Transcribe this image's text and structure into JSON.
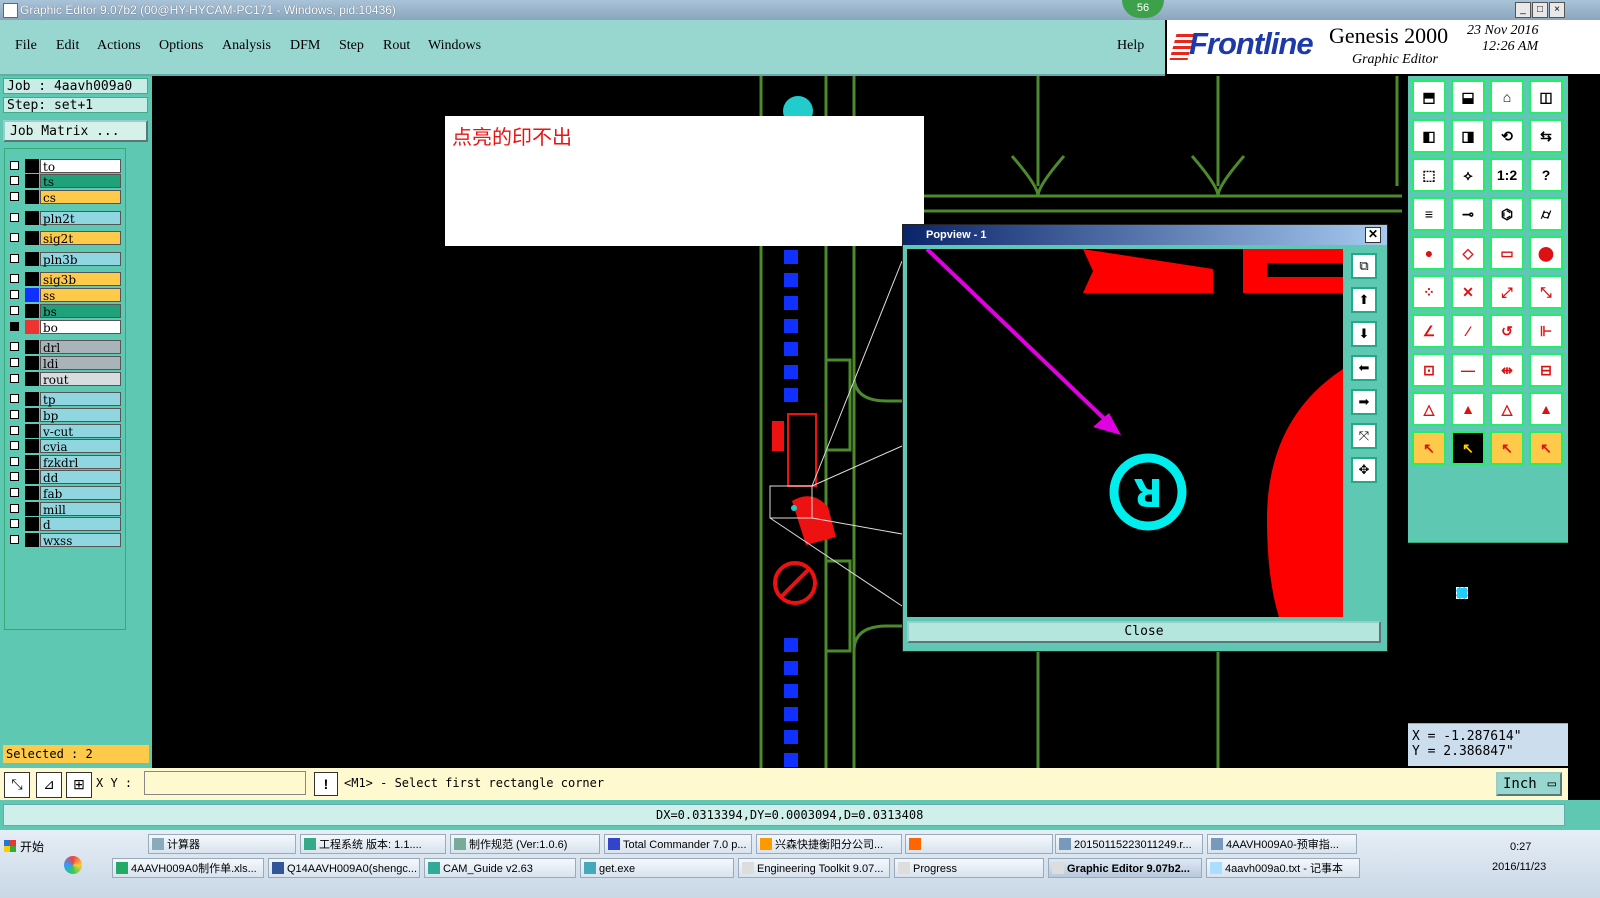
{
  "window": {
    "title": "Graphic Editor 9.07b2 (00@HY-HYCAM-PC171 - Windows, pid:10436)",
    "badge": "56",
    "buttons": [
      "_",
      "□",
      "×"
    ]
  },
  "menu": {
    "items": [
      "File",
      "Edit",
      "Actions",
      "Options",
      "Analysis",
      "DFM",
      "Step",
      "Rout",
      "Windows"
    ],
    "help": "Help"
  },
  "brand": {
    "logo": "Frontline",
    "product": "Genesis 2000",
    "subtitle": "Graphic Editor",
    "date": "23 Nov 2016",
    "time": "12:26 AM"
  },
  "job": {
    "job_line": "Job : 4aavh009a0",
    "step_line": "Step: set+1",
    "matrix_button": "Job Matrix ...",
    "selected": "Selected : 2"
  },
  "layers": [
    {
      "name": "to",
      "color": "#ffffff"
    },
    {
      "name": "ts",
      "color": "#1fa27a"
    },
    {
      "name": "cs",
      "color": "#ffc94a"
    },
    {
      "name": "pln2t",
      "color": "#8fd6e0"
    },
    {
      "name": "sig2t",
      "color": "#ffc94a"
    },
    {
      "name": "pln3b",
      "color": "#8fd6e0"
    },
    {
      "name": "sig3b",
      "color": "#ffc94a"
    },
    {
      "name": "ss",
      "color": "#ffc94a"
    },
    {
      "name": "bs",
      "color": "#1fa27a"
    },
    {
      "name": "bo",
      "color": "#ffffff"
    },
    {
      "name": "drl",
      "color": "#a9b4ba"
    },
    {
      "name": "ldi",
      "color": "#a9b4ba"
    },
    {
      "name": "rout",
      "color": "#d8dcde"
    },
    {
      "name": "tp",
      "color": "#8fd6e0"
    },
    {
      "name": "bp",
      "color": "#8fd6e0"
    },
    {
      "name": "v-cut",
      "color": "#8fd6e0"
    },
    {
      "name": "cvia",
      "color": "#8fd6e0"
    },
    {
      "name": "fzkdrl",
      "color": "#8fd6e0"
    },
    {
      "name": "dd",
      "color": "#8fd6e0"
    },
    {
      "name": "fab",
      "color": "#8fd6e0"
    },
    {
      "name": "mill",
      "color": "#8fd6e0"
    },
    {
      "name": "d",
      "color": "#8fd6e0"
    },
    {
      "name": "wxss",
      "color": "#8fd6e0"
    }
  ],
  "annotation": {
    "text": "点亮的印不出"
  },
  "popview": {
    "title": "Popview - 1",
    "close_label": "Close"
  },
  "coords": {
    "x": "X = -1.287614\"",
    "y": "Y = 2.386847\""
  },
  "command": {
    "xy_label": "X Y :",
    "input_value": "",
    "prompt": "<M1> - Select first rectangle corner",
    "units": "Inch"
  },
  "status": {
    "measure": "DX=0.0313394,DY=0.0003094,D=0.0313408"
  },
  "taskbar": {
    "start": "开始",
    "row1": [
      "计算器",
      "工程系统  版本: 1.1....",
      "制作规范 (Ver:1.0.6)",
      "Total Commander 7.0 p...",
      "兴森快捷衡阳分公司...",
      "",
      "20150115223011249.r...",
      "4AAVH009A0-预审指..."
    ],
    "row2": [
      "4AAVH009A0制作单.xls...",
      "Q14AAVH009A0(shengc...",
      "CAM_Guide v2.63",
      "get.exe",
      "Engineering Toolkit 9.07...",
      "Progress",
      "Graphic Editor 9.07b2...",
      "4aavh009a0.txt - 记事本"
    ],
    "clock_time": "0:27",
    "clock_date": "2016/11/23"
  }
}
